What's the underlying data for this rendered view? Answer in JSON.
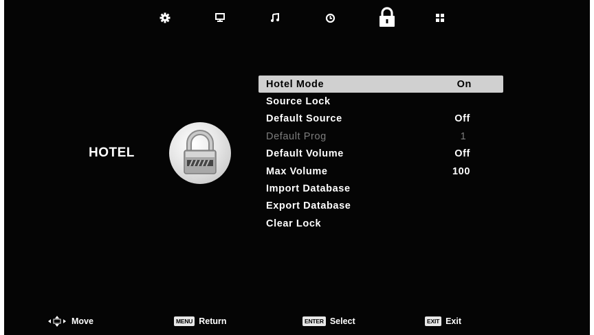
{
  "topbar": {
    "icons": [
      "gear-icon",
      "monitor-icon",
      "music-note-icon",
      "clock-icon",
      "lock-icon",
      "apps-grid-icon"
    ],
    "active": "lock-icon"
  },
  "section": {
    "title": "HOTEL",
    "badge_icon": "padlock-badge-icon"
  },
  "menu": {
    "items": [
      {
        "label": "Hotel Mode",
        "value": "On"
      },
      {
        "label": "Source Lock",
        "value": ""
      },
      {
        "label": "Default Source",
        "value": "Off"
      },
      {
        "label": "Default Prog",
        "value": "1"
      },
      {
        "label": "Default Volume",
        "value": "Off"
      },
      {
        "label": "Max Volume",
        "value": "100"
      },
      {
        "label": "Import Database",
        "value": ""
      },
      {
        "label": "Export Database",
        "value": ""
      },
      {
        "label": "Clear Lock",
        "value": ""
      }
    ],
    "selected_index": 0,
    "disabled_index": 3
  },
  "footer": {
    "move": {
      "icon": "dpad-arrows-icon",
      "label": "Move"
    },
    "return": {
      "key": "MENU",
      "label": "Return"
    },
    "select": {
      "key": "ENTER",
      "label": "Select"
    },
    "exit": {
      "key": "EXIT",
      "label": "Exit"
    }
  },
  "colors": {
    "background": "#050505",
    "text": "#ffffff",
    "highlight": "#d0d0d0",
    "disabled_text": "#7d7d7d"
  }
}
